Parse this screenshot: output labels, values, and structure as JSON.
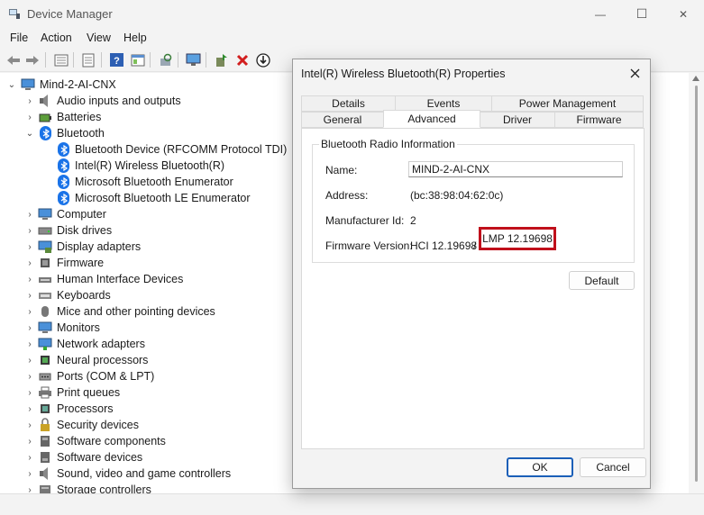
{
  "window": {
    "title": "Device Manager",
    "controls": {
      "minimize": "—",
      "maximize": "☐",
      "close": "✕"
    }
  },
  "menu": [
    "File",
    "Action",
    "View",
    "Help"
  ],
  "toolbar": {
    "icons": [
      "back-arrow-icon",
      "forward-arrow-icon",
      "properties-sheet-icon",
      "list-view-icon",
      "help-icon",
      "details-icon",
      "scan-hardware-icon",
      "monitor-icon",
      "update-driver-icon",
      "uninstall-icon",
      "download-icon"
    ]
  },
  "tree": {
    "root": "Mind-2-AI-CNX",
    "categories": [
      {
        "label": "Audio inputs and outputs",
        "icon": "speaker-icon"
      },
      {
        "label": "Batteries",
        "icon": "battery-icon"
      },
      {
        "label": "Bluetooth",
        "icon": "bluetooth-icon",
        "expanded": true,
        "children": [
          "Bluetooth Device (RFCOMM Protocol TDI)",
          "Intel(R) Wireless Bluetooth(R)",
          "Microsoft Bluetooth Enumerator",
          "Microsoft Bluetooth LE Enumerator"
        ]
      },
      {
        "label": "Computer",
        "icon": "computer-icon"
      },
      {
        "label": "Disk drives",
        "icon": "disk-icon"
      },
      {
        "label": "Display adapters",
        "icon": "display-adapter-icon"
      },
      {
        "label": "Firmware",
        "icon": "firmware-icon"
      },
      {
        "label": "Human Interface Devices",
        "icon": "hid-icon"
      },
      {
        "label": "Keyboards",
        "icon": "keyboard-icon"
      },
      {
        "label": "Mice and other pointing devices",
        "icon": "mouse-icon"
      },
      {
        "label": "Monitors",
        "icon": "monitor-icon"
      },
      {
        "label": "Network adapters",
        "icon": "network-icon"
      },
      {
        "label": "Neural processors",
        "icon": "chip-icon"
      },
      {
        "label": "Ports (COM & LPT)",
        "icon": "port-icon"
      },
      {
        "label": "Print queues",
        "icon": "printer-icon"
      },
      {
        "label": "Processors",
        "icon": "processor-icon"
      },
      {
        "label": "Security devices",
        "icon": "security-icon"
      },
      {
        "label": "Software components",
        "icon": "component-icon"
      },
      {
        "label": "Software devices",
        "icon": "software-device-icon"
      },
      {
        "label": "Sound, video and game controllers",
        "icon": "sound-icon"
      },
      {
        "label": "Storage controllers",
        "icon": "storage-icon"
      }
    ]
  },
  "dialog": {
    "title": "Intel(R) Wireless Bluetooth(R) Properties",
    "tabs_row1": [
      "Details",
      "Events",
      "Power Management"
    ],
    "tabs_row2": [
      "General",
      "Advanced",
      "Driver",
      "Firmware"
    ],
    "active_tab": "Advanced",
    "group_title": "Bluetooth Radio Information",
    "fields": {
      "name_label": "Name:",
      "name_value": "MIND-2-AI-CNX",
      "address_label": "Address:",
      "address_value": "(bc:38:98:04:62:0c)",
      "manufacturer_label": "Manufacturer Id:",
      "manufacturer_value": "2",
      "firmware_label": "Firmware Version:",
      "hci_value": "HCI 12.19698",
      "separator": "/",
      "lmp_value": "LMP 12.19698"
    },
    "default_button": "Default",
    "ok_button": "OK",
    "cancel_button": "Cancel",
    "highlight_color": "#c0101b"
  }
}
